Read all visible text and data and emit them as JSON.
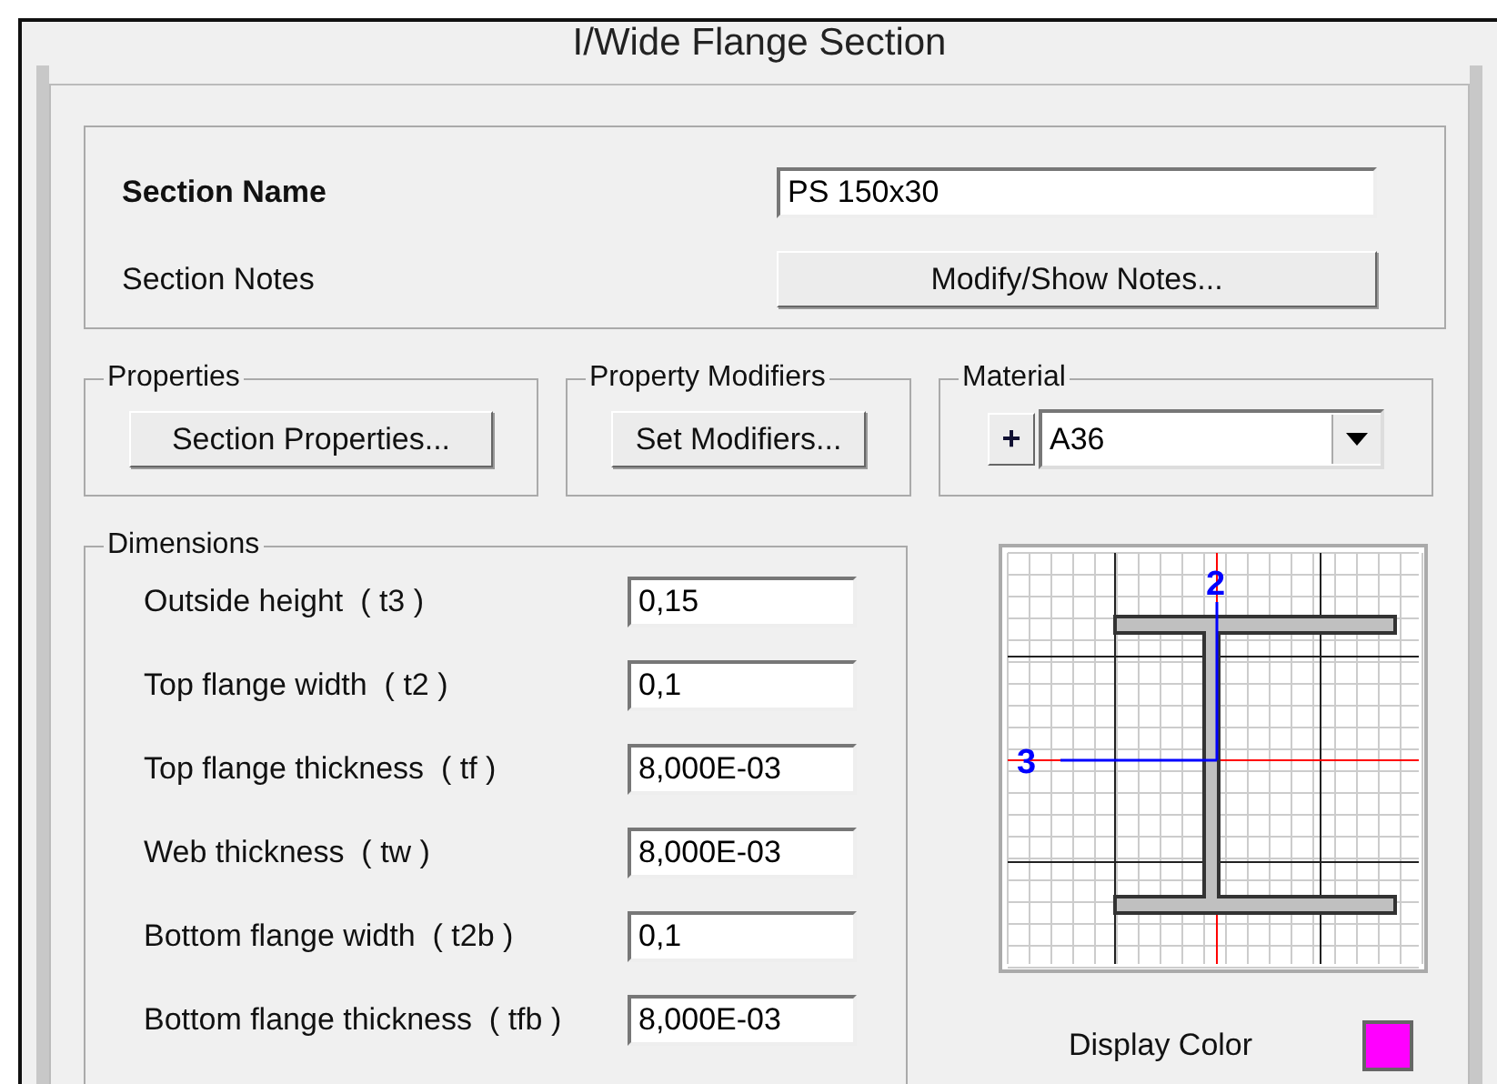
{
  "window": {
    "title": "I/Wide Flange Section"
  },
  "section": {
    "name_label": "Section Name",
    "name_value": "PS 150x30",
    "notes_label": "Section Notes",
    "notes_button": "Modify/Show Notes..."
  },
  "properties": {
    "title": "Properties",
    "button": "Section Properties..."
  },
  "property_modifiers": {
    "title": "Property Modifiers",
    "button": "Set Modifiers..."
  },
  "material": {
    "title": "Material",
    "add_button": "+",
    "value": "A36"
  },
  "dimensions": {
    "title": "Dimensions",
    "rows": [
      {
        "label": "Outside height  ( t3 )",
        "value": "0,15"
      },
      {
        "label": "Top flange width  ( t2 )",
        "value": "0,1"
      },
      {
        "label": "Top flange thickness  ( tf )",
        "value": "8,000E-03"
      },
      {
        "label": "Web thickness  ( tw )",
        "value": "8,000E-03"
      },
      {
        "label": "Bottom flange width  ( t2b )",
        "value": "0,1"
      },
      {
        "label": "Bottom flange thickness  ( tfb )",
        "value": "8,000E-03"
      }
    ]
  },
  "diagram": {
    "axis_2": "2",
    "axis_3": "3"
  },
  "display_color": {
    "label": "Display Color",
    "color": "#ff00ff"
  }
}
